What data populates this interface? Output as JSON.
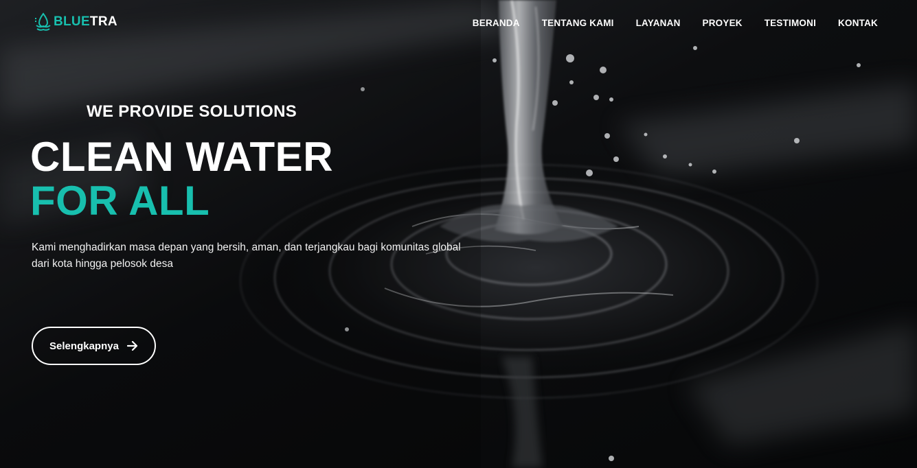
{
  "brand": {
    "name_part1": "BLUE",
    "name_part2": "TRA",
    "accent_color": "#18bfae"
  },
  "nav": {
    "items": [
      {
        "label": "BERANDA"
      },
      {
        "label": "TENTANG KAMI"
      },
      {
        "label": "LAYANAN"
      },
      {
        "label": "PROYEK"
      },
      {
        "label": "TESTIMONI"
      },
      {
        "label": "KONTAK"
      }
    ]
  },
  "hero": {
    "subheading": "WE PROVIDE SOLUTIONS",
    "title_line1": "CLEAN WATER",
    "title_line2": "FOR ALL",
    "description": "Kami menghadirkan masa depan yang bersih, aman, dan terjangkau bagi komunitas global dari kota hingga pelosok desa",
    "cta_label": "Selengkapnya",
    "cta_icon": "arrow-right-icon",
    "background": "water-splash-image"
  }
}
